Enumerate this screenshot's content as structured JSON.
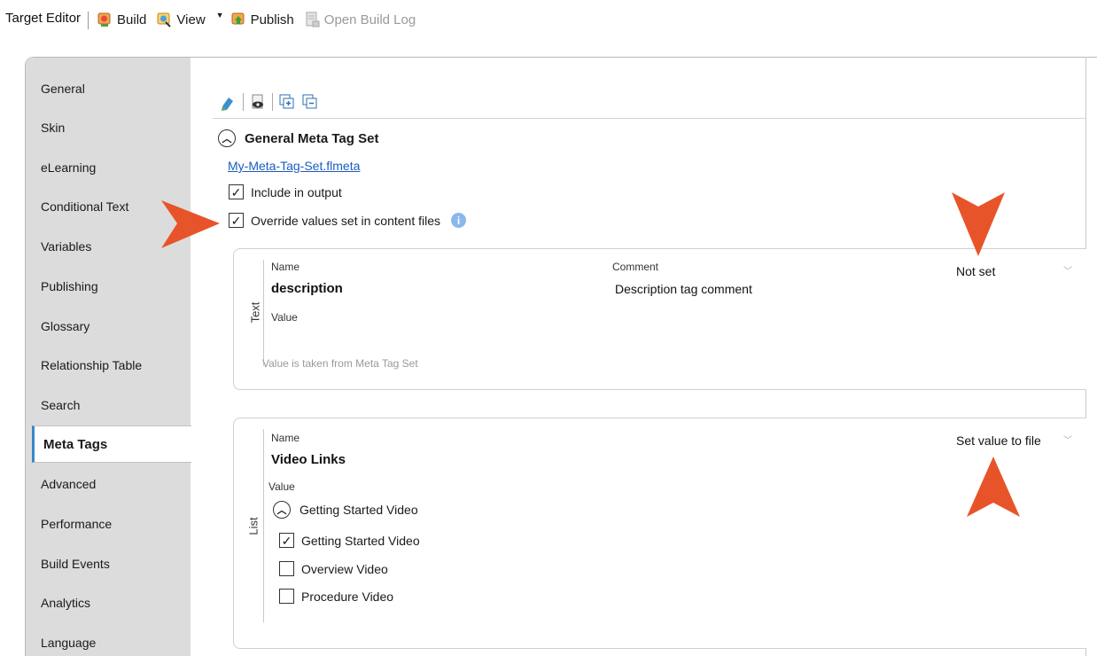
{
  "toolbar": {
    "title": "Target Editor",
    "build_label": "Build",
    "view_label": "View",
    "publish_label": "Publish",
    "open_build_log_label": "Open Build Log"
  },
  "sidebar": {
    "items": [
      {
        "label": "General"
      },
      {
        "label": "Skin"
      },
      {
        "label": "eLearning"
      },
      {
        "label": "Conditional Text"
      },
      {
        "label": "Variables"
      },
      {
        "label": "Publishing"
      },
      {
        "label": "Glossary"
      },
      {
        "label": "Relationship Table"
      },
      {
        "label": "Search"
      },
      {
        "label": "Meta Tags"
      },
      {
        "label": "Advanced"
      },
      {
        "label": "Performance"
      },
      {
        "label": "Build Events"
      },
      {
        "label": "Analytics"
      },
      {
        "label": "Language"
      }
    ],
    "active_index": 9
  },
  "section": {
    "title": "General Meta Tag Set",
    "file_link": "My-Meta-Tag-Set.flmeta",
    "include_label": "Include in output",
    "include_checked": true,
    "override_label": "Override values set in content files",
    "override_checked": true
  },
  "text_card": {
    "type_label": "Text",
    "name_label": "Name",
    "name_value": "description",
    "comment_label": "Comment",
    "comment_value": "Description tag comment",
    "value_label": "Value",
    "value_hint": "Value is taken from Meta Tag Set",
    "select_value": "Not set"
  },
  "list_card": {
    "type_label": "List",
    "name_label": "Name",
    "name_value": "Video Links",
    "value_label": "Value",
    "select_value": "Set value to file",
    "group_label": "Getting Started Video",
    "options": [
      {
        "label": "Getting Started Video",
        "checked": true
      },
      {
        "label": "Overview Video",
        "checked": false
      },
      {
        "label": "Procedure Video",
        "checked": false
      }
    ]
  },
  "colors": {
    "accent_arrow": "#e8542a",
    "link": "#1a5dbe",
    "active_border": "#3a87c8",
    "sidebar_bg": "#dcdcdc"
  }
}
